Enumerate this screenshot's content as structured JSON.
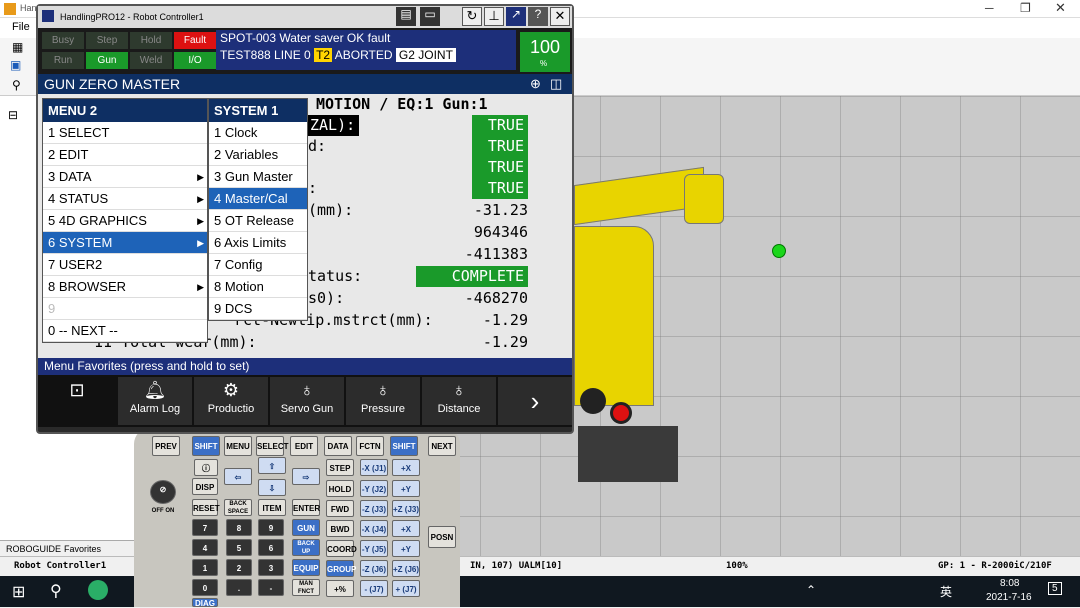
{
  "background_app": {
    "title_short": "Han",
    "menu_file": "File",
    "tab_roboguide": "ROBOGUIDE",
    "tab_favorites": "Favorites",
    "status_left": "Robot Controller1",
    "status_mid": "IN, 107) UALM[10]",
    "status_zoom": "100%",
    "status_right": "GP: 1 - R-2000iC/210F"
  },
  "pendant": {
    "window_title": "HandlingPRO12 - Robot Controller1",
    "leds": {
      "busy": "Busy",
      "step": "Step",
      "hold": "Hold",
      "fault": "Fault",
      "run": "Run",
      "gun": "Gun",
      "weld": "Weld",
      "io": "I/O"
    },
    "alarm_line1": "SPOT-003 Water saver OK fault",
    "alarm_line2_a": "TEST888 LINE 0",
    "alarm_line2_t2": "T2",
    "alarm_line2_b": "ABORTED",
    "alarm_line2_joint": "G2 JOINT",
    "override": "100",
    "override_unit": "%",
    "screen_title": "GUN ZERO MASTER",
    "screen_rows": {
      "header": "MOTION / EQ:1 Gun:1",
      "r1_label": "ZAL):",
      "r1_val": "TRUE",
      "r2_label": "d:",
      "r2_val": "TRUE",
      "r3_val": "TRUE",
      "r4_label": ":",
      "r4_val": "TRUE",
      "r5_label": "(mm):",
      "r5_val": "-31.23",
      "r6_val": "964346",
      "r7_val": "-411383",
      "r8_label": "tatus:",
      "r8_val": "COMPLETE",
      "r9_label": "s0):",
      "r9_val": "-468270",
      "r10_label": "rct-Newtip.mstrct(mm):",
      "r10_val": "-1.29",
      "r11_label": "11 Total wear(mm):",
      "r11_val": "-1.29"
    },
    "menu1": {
      "header": "MENU  2",
      "items": [
        "1 SELECT",
        "2 EDIT",
        "3 DATA",
        "4 STATUS",
        "5 4D GRAPHICS",
        "6 SYSTEM",
        "7 USER2",
        "8 BROWSER",
        "9",
        "0 -- NEXT --"
      ]
    },
    "menu2": {
      "header": "SYSTEM  1",
      "items": [
        "1 Clock",
        "2 Variables",
        "3 Gun Master",
        "4 Master/Cal",
        "5 OT Release",
        "6 Axis Limits",
        "7 Config",
        "8 Motion",
        "9 DCS"
      ]
    },
    "favorites_hint": "Menu Favorites (press and hold to set)",
    "favorites": [
      "Alarm Log",
      "Productio",
      "Servo Gun",
      "Pressure",
      "Distance"
    ]
  },
  "keypad": {
    "row1": [
      "PREV",
      "SHIFT",
      "MENU",
      "SELECT",
      "EDIT",
      "DATA",
      "FCTN",
      "SHIFT",
      "NEXT"
    ],
    "step": "STEP",
    "hold": "HOLD",
    "fwd": "FWD",
    "bwd": "BWD",
    "coord": "COORD",
    "group": "GROUP",
    "disp": "DISP",
    "reset": "RESET",
    "backspace": "BACK SPACE",
    "item": "ITEM",
    "enter": "ENTER",
    "gun": "GUN",
    "backup": "BACK UP",
    "equip": "EQUIP",
    "manfnct": "MAN FNCT",
    "posn": "POSN",
    "diag": "DIAG",
    "offon": "OFF  ON",
    "jog_minus": [
      "-X (J1)",
      "-Y (J2)",
      "-Z (J3)",
      "-X (J4)",
      "-Y (J5)",
      "-Z (J6)",
      "- (J7)"
    ],
    "jog_plus": [
      "+X (J1)",
      "+Y (J2)",
      "+Z (J3)",
      "+X (J4)",
      "+Y (J5)",
      "+Z (J6)",
      "+ (J7)"
    ],
    "digits": [
      "7",
      "8",
      "9",
      "4",
      "5",
      "6",
      "1",
      "2",
      "3",
      "0",
      ".",
      "-"
    ]
  },
  "taskbar": {
    "ime": "英",
    "time": "8:08",
    "date": "2021-7-16",
    "notif_count": "5"
  },
  "colors": {
    "pendant_blue": "#1d2f7a",
    "status_green": "#1a9a2a",
    "menu_select": "#1e63b8",
    "robot_yellow": "#e8d400"
  }
}
